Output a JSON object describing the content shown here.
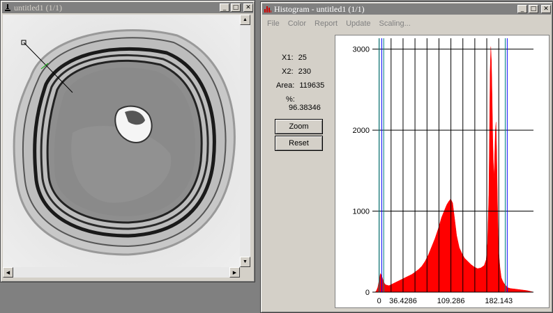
{
  "image_window": {
    "title": "untitled1 (1/1)",
    "icon": "microscope-icon",
    "buttons": [
      "minimize-icon",
      "maximize-icon",
      "close-icon"
    ]
  },
  "histogram_window": {
    "title": "Histogram - untitled1 (1/1)",
    "icon": "histogram-icon",
    "menu": [
      "File",
      "Color",
      "Report",
      "Update",
      "Scaling..."
    ],
    "stats": {
      "x1_label": "X1:",
      "x1_value": "25",
      "x2_label": "X2:",
      "x2_value": "230",
      "area_label": "Area:",
      "area_value": "119635",
      "pct_label": "%:",
      "pct_value": "96.38346"
    },
    "zoom_label": "Zoom",
    "reset_label": "Reset"
  },
  "chart_data": {
    "type": "area",
    "color": "#ff0000",
    "xlim": [
      -6,
      235
    ],
    "ylim": [
      0,
      3100
    ],
    "yticks": [
      0,
      1000,
      2000,
      3000
    ],
    "ytick_labels": [
      "0",
      "1000",
      "2000",
      "3000"
    ],
    "xticks": [
      0,
      36.4286,
      109.286,
      182.143
    ],
    "xtick_labels": [
      "0",
      "36.4286",
      "109.286",
      "182.143"
    ],
    "x_gridlines": [
      0,
      18.2,
      36.4286,
      54.6,
      72.9,
      91.1,
      109.286,
      127.5,
      145.7,
      163.9,
      182.143
    ],
    "y_gridlines": [
      0,
      1000,
      2000,
      3000
    ],
    "marker_lines": [
      {
        "x": 0,
        "color": "#008080"
      },
      {
        "x": 4,
        "color": "#0000ff"
      },
      {
        "x": 7,
        "color": "#008080"
      },
      {
        "x": 192,
        "color": "#008080"
      },
      {
        "x": 195,
        "color": "#0000ff"
      }
    ],
    "x": [
      -6,
      -4,
      -2,
      0,
      2,
      4,
      6,
      8,
      10,
      15,
      20,
      25,
      30,
      35,
      40,
      45,
      50,
      55,
      60,
      65,
      70,
      75,
      80,
      85,
      90,
      95,
      100,
      103,
      106,
      109,
      112,
      115,
      118,
      122,
      126,
      130,
      135,
      140,
      145,
      150,
      155,
      160,
      163,
      165,
      167,
      168,
      169,
      170,
      171,
      172,
      173,
      174,
      175,
      176,
      177,
      178,
      179,
      180,
      181,
      182,
      184,
      186,
      188,
      190,
      192,
      194,
      196,
      200,
      205,
      210,
      215,
      220,
      225,
      230,
      235
    ],
    "y": [
      0,
      20,
      60,
      150,
      230,
      200,
      150,
      110,
      90,
      80,
      100,
      120,
      140,
      160,
      180,
      200,
      220,
      250,
      280,
      320,
      380,
      460,
      560,
      660,
      780,
      920,
      1020,
      1080,
      1120,
      1150,
      1100,
      900,
      700,
      550,
      480,
      420,
      380,
      340,
      310,
      290,
      300,
      330,
      400,
      600,
      1200,
      1900,
      2700,
      3030,
      2850,
      2400,
      1900,
      1600,
      1400,
      1700,
      2000,
      2100,
      1700,
      1200,
      800,
      500,
      300,
      180,
      140,
      110,
      90,
      70,
      55,
      45,
      40,
      35,
      30,
      25,
      20,
      10,
      0
    ]
  }
}
